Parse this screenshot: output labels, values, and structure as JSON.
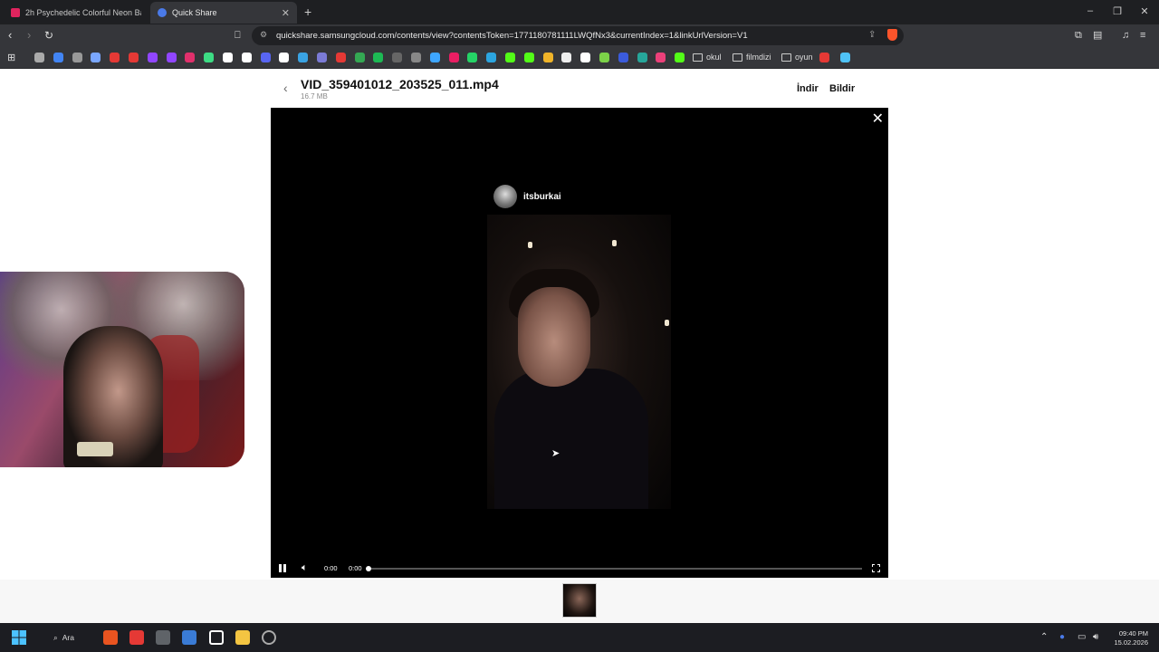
{
  "browser": {
    "tabs": [
      {
        "title": "2h Psychedelic Colorful Neon Backgr...",
        "favicon_color": "#e0245e"
      },
      {
        "title": "Quick Share",
        "favicon_color": "#4a7ae8"
      }
    ],
    "new_tab_glyph": "+",
    "url": "quickshare.samsungcloud.com/contents/view?contentsToken=1771180781111LWQfNx3&currentIndex=1&linkUrlVersion=V1",
    "bookmark_folders": [
      "okul",
      "filmdizi",
      "oyun"
    ],
    "bookmark_colors": [
      "#aaaaaa",
      "#4285f4",
      "#999999",
      "#7aa7ff",
      "#e53935",
      "#e53935",
      "#9146ff",
      "#9146ff",
      "#e1306c",
      "#3ddc84",
      "#ffffff",
      "#ffffff",
      "#5865f2",
      "#ffffff",
      "#3aa3e3",
      "#7b7bd6",
      "#e53935",
      "#34a853",
      "#1db954",
      "#666666",
      "#888888",
      "#3ea6ff",
      "#e91e63",
      "#25d366",
      "#2ca5e0",
      "#53fc18",
      "#53fc18",
      "#f0b429",
      "#eeeeee",
      "#ffffff",
      "#7bd148",
      "#3b5bdb",
      "#26a69a",
      "#ec407a",
      "#53fc18",
      "#4fc3f7",
      "#e53935"
    ]
  },
  "page": {
    "file_name": "VID_359401012_203525_011.mp4",
    "file_size": "16.7 MB",
    "download_label": "İndir",
    "report_label": "Bildir",
    "close_glyph": "✕",
    "uploader": "itsburkai",
    "current_time": "0:00",
    "duration": "0:00",
    "progress_fraction": 0.0
  },
  "taskbar": {
    "search_label": "Ara",
    "time": "09:40 PM",
    "date": "15.02.2026",
    "app_colors": [
      "#e95420",
      "#e53935",
      "#5f6368",
      "#3a7bd5",
      "#ffffff",
      "#f4c542",
      "#888888"
    ]
  }
}
